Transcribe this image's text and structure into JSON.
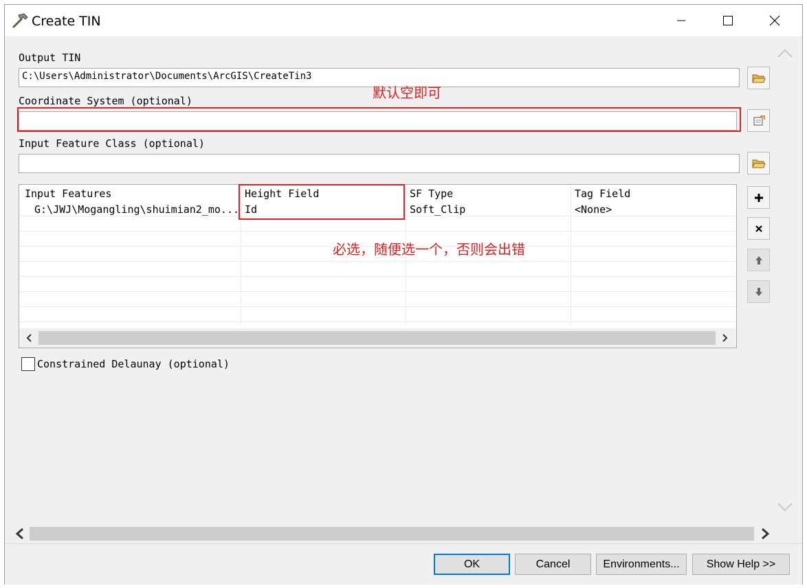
{
  "window": {
    "title": "Create TIN",
    "controls": {
      "minimize": "minimize-icon",
      "maximize": "maximize-icon",
      "close": "close-icon"
    }
  },
  "form": {
    "output_tin": {
      "label": "Output TIN",
      "value": "C:\\Users\\Administrator\\Documents\\ArcGIS\\CreateTin3"
    },
    "coordinate_system": {
      "label": "Coordinate System (optional)",
      "value": ""
    },
    "input_feature_class": {
      "label": "Input Feature Class (optional)",
      "value": ""
    },
    "table": {
      "headers": [
        "Input Features",
        "Height Field",
        "SF Type",
        "Tag Field"
      ],
      "rows": [
        [
          "G:\\JWJ\\Mogangling\\shuimian2_mo...",
          "Id",
          "Soft_Clip",
          "<None>"
        ]
      ]
    },
    "constrained_delaunay": {
      "label": "Constrained Delaunay (optional)",
      "checked": false
    }
  },
  "annotations": {
    "coord_note": "默认空即可",
    "height_note": "必选，随便选一个，否则会出错",
    "color": "#e02020"
  },
  "buttons": {
    "ok": "OK",
    "cancel": "Cancel",
    "environments": "Environments...",
    "show_help": "Show Help >>"
  },
  "colors": {
    "accent": "#0078d7",
    "window_bg": "#f0f0f0"
  }
}
